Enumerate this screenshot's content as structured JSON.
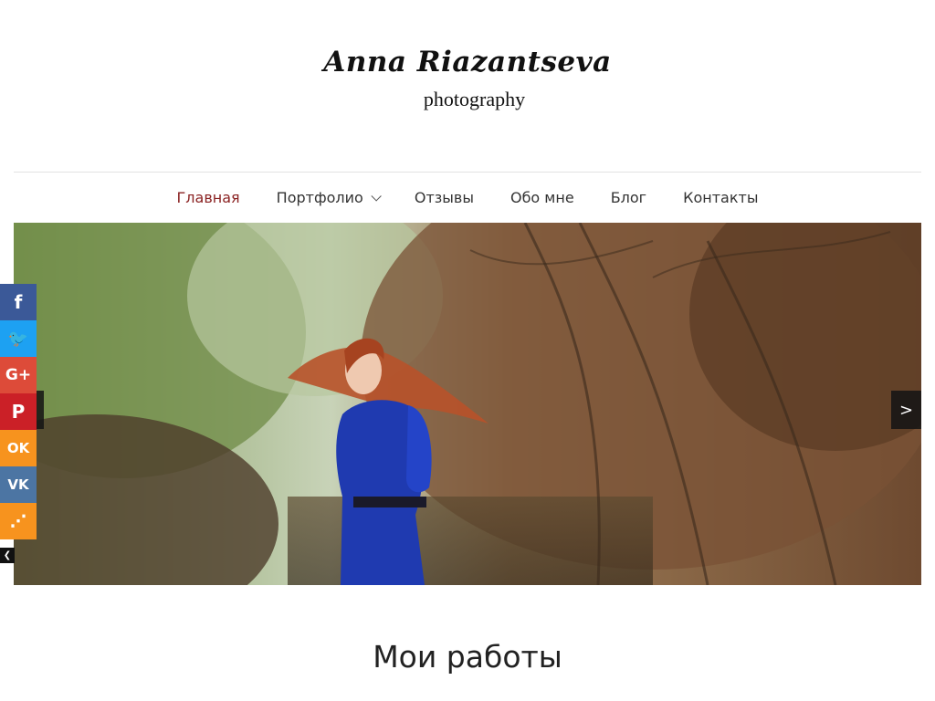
{
  "site": {
    "title": "Anna Riazantseva",
    "subtitle": "photography"
  },
  "nav": {
    "items": [
      {
        "label": "Главная",
        "active": true
      },
      {
        "label": "Портфолио",
        "has_dropdown": true
      },
      {
        "label": "Отзывы"
      },
      {
        "label": "Обо мне"
      },
      {
        "label": "Блог"
      },
      {
        "label": "Контакты"
      }
    ],
    "active_color": "#8b2323"
  },
  "slider": {
    "prev_label": "<",
    "next_label": ">"
  },
  "share": {
    "buttons": [
      {
        "network": "facebook",
        "icon": "facebook-icon",
        "glyph": "f",
        "color": "#3b5998"
      },
      {
        "network": "twitter",
        "icon": "twitter-icon",
        "glyph": "🐦",
        "color": "#1da1f2"
      },
      {
        "network": "google-plus",
        "icon": "google-plus-icon",
        "glyph": "G+",
        "color": "#dd4b39"
      },
      {
        "network": "pinterest",
        "icon": "pinterest-icon",
        "glyph": "P",
        "color": "#cb2027"
      },
      {
        "network": "odnoklassniki",
        "icon": "odnoklassniki-icon",
        "glyph": "OK",
        "color": "#f7931e"
      },
      {
        "network": "vkontakte",
        "icon": "vk-icon",
        "glyph": "VK",
        "color": "#4c75a3"
      },
      {
        "network": "more",
        "icon": "share-icon",
        "glyph": "⋰",
        "color": "#f7931e"
      }
    ],
    "toggle_glyph": "❮"
  },
  "main": {
    "section_title": "Мои работы"
  }
}
